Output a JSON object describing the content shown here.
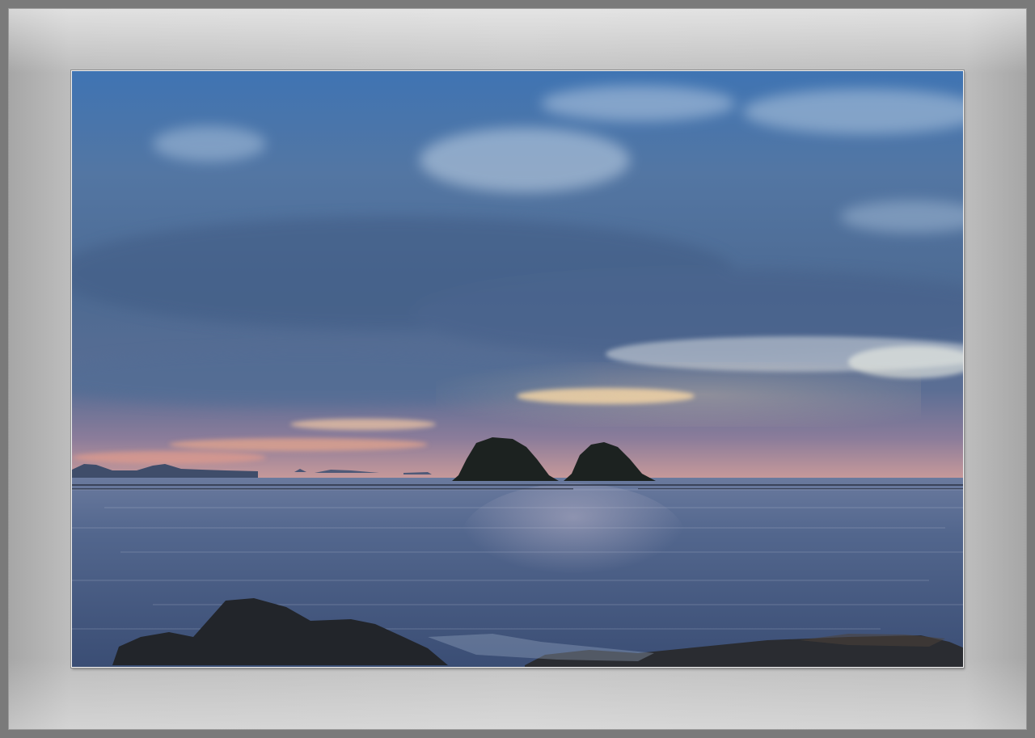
{
  "scene": {
    "description_tag": "seascape-photo",
    "colors": {
      "frame_dark": "#7a7a7a",
      "mat_light": "#c4c4c4",
      "sky_top": "#3e6fa8",
      "sky_mid": "#51709b",
      "horizon_glow": "#e8a78c",
      "sea": "#4a5f86",
      "islets": "#1c2220",
      "rocks": "#22252a"
    }
  }
}
